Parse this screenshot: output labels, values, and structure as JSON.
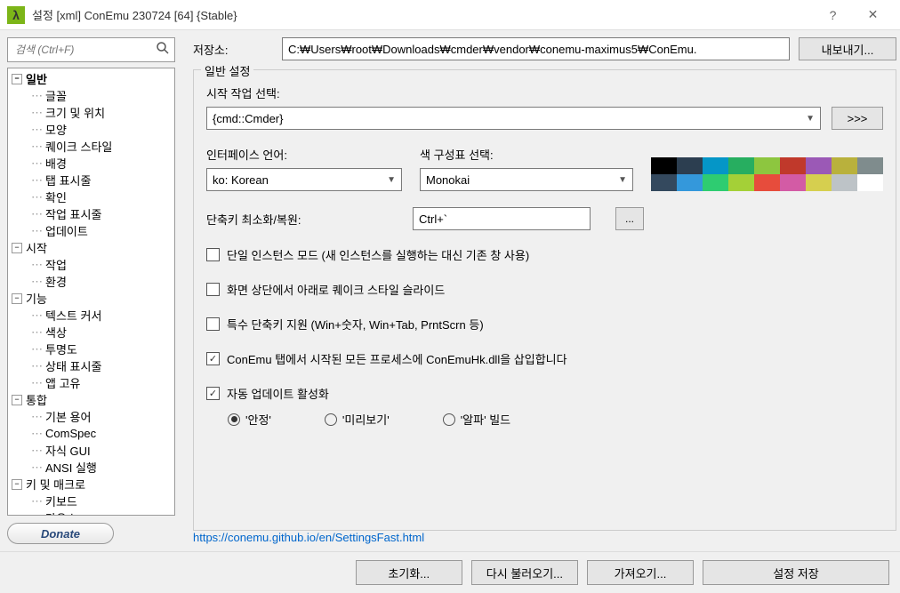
{
  "title": "설정 [xml] ConEmu 230724 [64] {Stable}",
  "search_placeholder": "검색 (Ctrl+F)",
  "tree": [
    {
      "label": "일반",
      "bold": true,
      "expanded": true,
      "children": [
        {
          "label": "글꼴"
        },
        {
          "label": "크기 및 위치"
        },
        {
          "label": "모양"
        },
        {
          "label": "퀘이크 스타일"
        },
        {
          "label": "배경"
        },
        {
          "label": "탭 표시줄"
        },
        {
          "label": "확인"
        },
        {
          "label": "작업 표시줄"
        },
        {
          "label": "업데이트"
        }
      ]
    },
    {
      "label": "시작",
      "expanded": true,
      "children": [
        {
          "label": "작업"
        },
        {
          "label": "환경"
        }
      ]
    },
    {
      "label": "기능",
      "expanded": true,
      "children": [
        {
          "label": "텍스트 커서"
        },
        {
          "label": "색상"
        },
        {
          "label": "투명도"
        },
        {
          "label": "상태 표시줄"
        },
        {
          "label": "앱 고유"
        }
      ]
    },
    {
      "label": "통합",
      "expanded": true,
      "children": [
        {
          "label": "기본 용어"
        },
        {
          "label": "ComSpec"
        },
        {
          "label": "자식 GUI"
        },
        {
          "label": "ANSI 실행"
        }
      ]
    },
    {
      "label": "키 및 매크로",
      "expanded": true,
      "children": [
        {
          "label": "키보드"
        },
        {
          "label": "마우스"
        }
      ]
    }
  ],
  "donate": "Donate",
  "storage_label": "저장소:",
  "storage_path": "C:₩Users₩root₩Downloads₩cmder₩vendor₩conemu-maximus5₩ConEmu.",
  "export_btn": "내보내기...",
  "group_title": "일반 설정",
  "startup_label": "시작 작업 선택:",
  "startup_value": "{cmd::Cmder}",
  "more_btn": ">>>",
  "lang_label": "인터페이스 언어:",
  "lang_value": "ko: Korean",
  "scheme_label": "색 구성표 선택:",
  "scheme_value": "Monokai",
  "hotkey_label": "단축키 최소화/복원:",
  "hotkey_value": "Ctrl+`",
  "chk_single": "단일 인스턴스 모드 (새 인스턴스를 실행하는 대신 기존 창 사용)",
  "chk_quake": "화면 상단에서 아래로 퀘이크 스타일 슬라이드",
  "chk_special": "특수 단축키 지원 (Win+숫자, Win+Tab, PrntScrn 등)",
  "chk_inject": "ConEmu 탭에서 시작된 모든 프로세스에 ConEmuHk.dll을 삽입합니다",
  "chk_update": "자동 업데이트 활성화",
  "radio_stable": "'안정'",
  "radio_preview": "'미리보기'",
  "radio_alpha": "'알파' 빌드",
  "help_link": "https://conemu.github.io/en/SettingsFast.html",
  "btn_reset": "초기화...",
  "btn_reload": "다시 불러오기...",
  "btn_import": "가져오기...",
  "btn_save": "설정 저장",
  "palette_top": [
    "#000000",
    "#2c3e50",
    "#0596c7",
    "#27ae60",
    "#8dc63f",
    "#c0392b",
    "#9b59b6",
    "#b9b13c",
    "#7f8c8d"
  ],
  "palette_bottom": [
    "#34495e",
    "#3498db",
    "#2ecc71",
    "#a4d037",
    "#e74c3c",
    "#d35ba5",
    "#d6cf4f",
    "#bdc3c7",
    "#ffffff"
  ]
}
